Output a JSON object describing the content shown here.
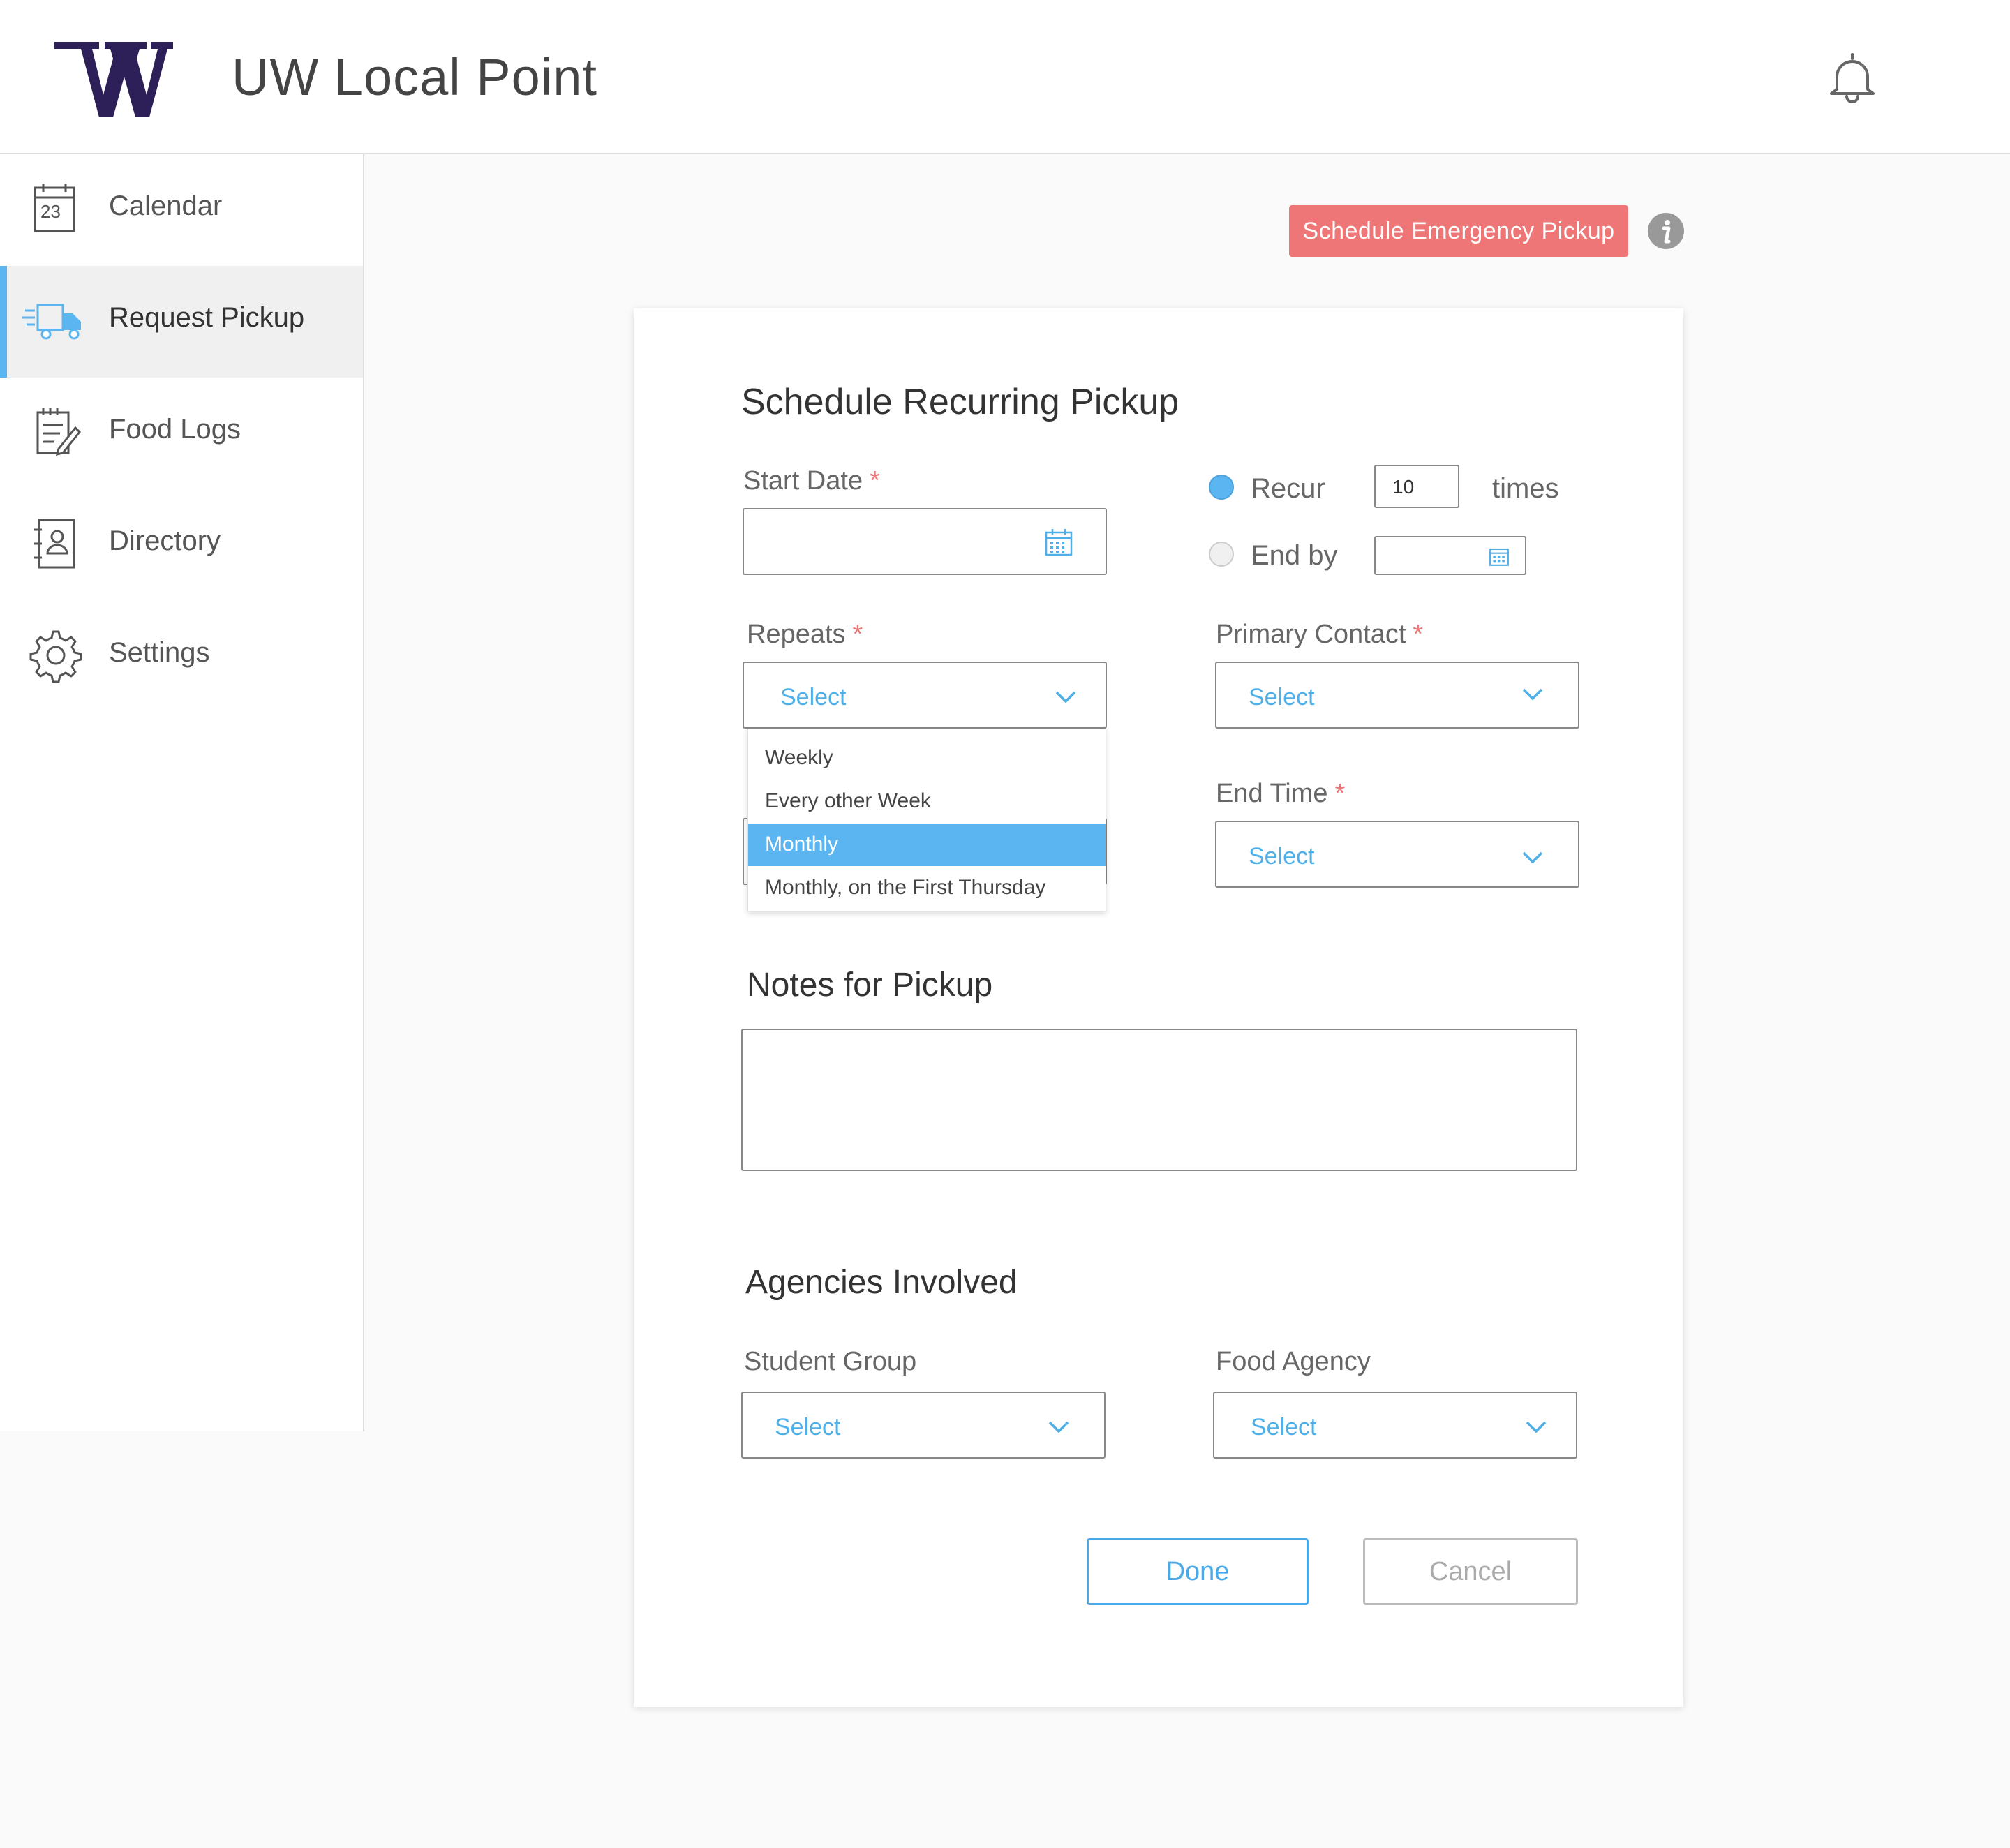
{
  "app": {
    "title": "UW Local Point"
  },
  "sidebar": {
    "items": [
      {
        "label": "Calendar",
        "icon": "calendar-icon",
        "calendar_day": "23"
      },
      {
        "label": "Request Pickup",
        "icon": "delivery-truck-icon",
        "active": true
      },
      {
        "label": "Food Logs",
        "icon": "notepad-edit-icon"
      },
      {
        "label": "Directory",
        "icon": "address-book-icon"
      },
      {
        "label": "Settings",
        "icon": "gear-icon"
      }
    ]
  },
  "toolbar": {
    "emergency_label": "Schedule Emergency Pickup"
  },
  "form": {
    "title": "Schedule Recurring Pickup",
    "start_date": {
      "label": "Start Date",
      "required": "*",
      "value": ""
    },
    "recur": {
      "label": "Recur",
      "value": "10",
      "suffix": "times",
      "selected": true
    },
    "end_by": {
      "label": "End by",
      "value": "",
      "selected": false
    },
    "repeats": {
      "label": "Repeats",
      "required": "*",
      "value": "Select",
      "options": [
        "Weekly",
        "Every other Week",
        "Monthly",
        "Monthly, on the First Thursday"
      ],
      "highlighted": "Monthly"
    },
    "primary_contact": {
      "label": "Primary Contact",
      "required": "*",
      "value": "Select"
    },
    "end_time": {
      "label": "End Time",
      "required": "*",
      "value": "Select"
    },
    "notes": {
      "title": "Notes for Pickup",
      "value": ""
    },
    "agencies": {
      "title": "Agencies Involved",
      "student_group": {
        "label": "Student Group",
        "value": "Select"
      },
      "food_agency": {
        "label": "Food Agency",
        "value": "Select"
      }
    },
    "done_label": "Done",
    "cancel_label": "Cancel"
  },
  "colors": {
    "brand_purple": "#2d1f57",
    "accent_blue": "#5bb5f0",
    "emergency_red": "#ef7676"
  }
}
